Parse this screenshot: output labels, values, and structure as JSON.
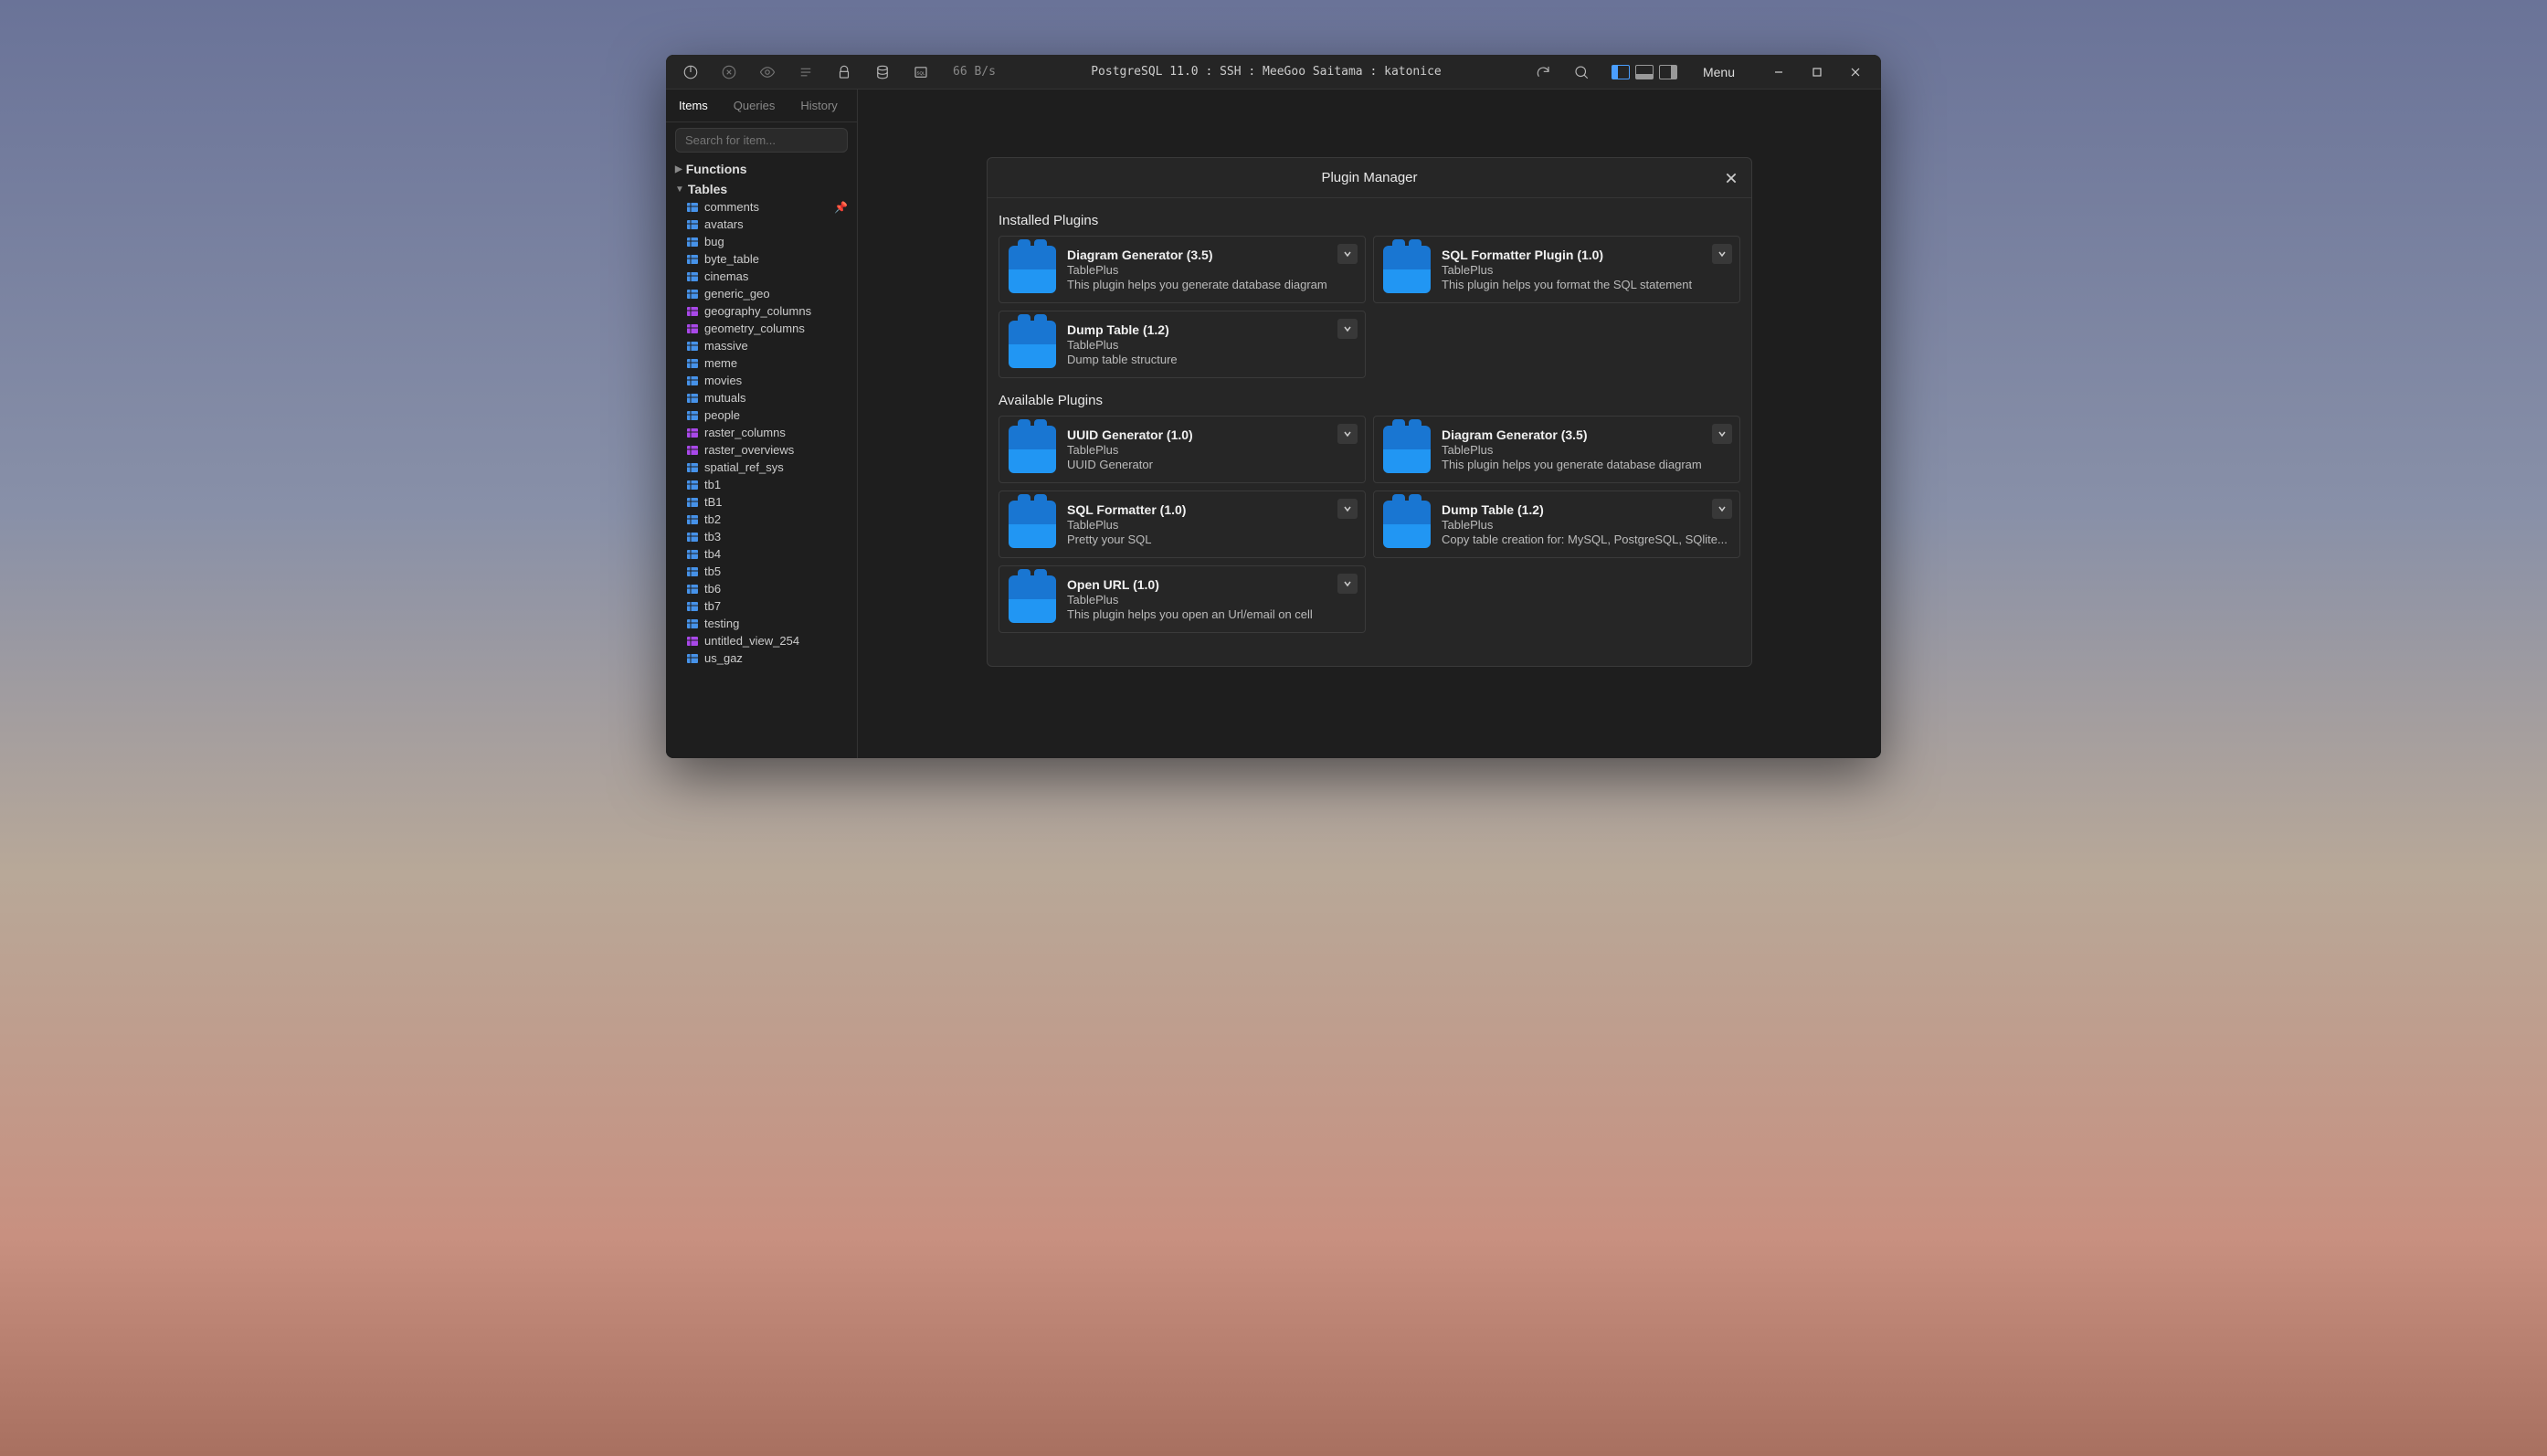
{
  "titlebar": {
    "status": "66 B/s",
    "connection": "PostgreSQL 11.0 : SSH : MeeGoo Saitama : katonice",
    "menu_label": "Menu"
  },
  "sidebar": {
    "tabs": [
      {
        "label": "Items",
        "active": true
      },
      {
        "label": "Queries",
        "active": false
      },
      {
        "label": "History",
        "active": false
      }
    ],
    "search_placeholder": "Search for item...",
    "sections": [
      {
        "label": "Functions",
        "expanded": false
      },
      {
        "label": "Tables",
        "expanded": true
      }
    ],
    "tables": [
      {
        "name": "comments",
        "kind": "table",
        "pinned": true
      },
      {
        "name": "avatars",
        "kind": "table"
      },
      {
        "name": "bug",
        "kind": "table"
      },
      {
        "name": "byte_table",
        "kind": "table"
      },
      {
        "name": "cinemas",
        "kind": "table"
      },
      {
        "name": "generic_geo",
        "kind": "table"
      },
      {
        "name": "geography_columns",
        "kind": "view"
      },
      {
        "name": "geometry_columns",
        "kind": "view"
      },
      {
        "name": "massive",
        "kind": "table"
      },
      {
        "name": "meme",
        "kind": "table"
      },
      {
        "name": "movies",
        "kind": "table"
      },
      {
        "name": "mutuals",
        "kind": "table"
      },
      {
        "name": "people",
        "kind": "table"
      },
      {
        "name": "raster_columns",
        "kind": "view"
      },
      {
        "name": "raster_overviews",
        "kind": "view"
      },
      {
        "name": "spatial_ref_sys",
        "kind": "table"
      },
      {
        "name": "tb1",
        "kind": "table"
      },
      {
        "name": "tB1",
        "kind": "table"
      },
      {
        "name": "tb2",
        "kind": "table"
      },
      {
        "name": "tb3",
        "kind": "table"
      },
      {
        "name": "tb4",
        "kind": "table"
      },
      {
        "name": "tb5",
        "kind": "table"
      },
      {
        "name": "tb6",
        "kind": "table"
      },
      {
        "name": "tb7",
        "kind": "table"
      },
      {
        "name": "testing",
        "kind": "table"
      },
      {
        "name": "untitled_view_254",
        "kind": "view"
      },
      {
        "name": "us_gaz",
        "kind": "table"
      }
    ]
  },
  "dialog": {
    "title": "Plugin Manager",
    "installed_label": "Installed Plugins",
    "available_label": "Available Plugins",
    "installed": [
      {
        "name": "Diagram Generator (3.5)",
        "author": "TablePlus",
        "desc": "This plugin helps you generate database diagram"
      },
      {
        "name": "SQL Formatter Plugin (1.0)",
        "author": "TablePlus",
        "desc": "This plugin helps you format the SQL statement"
      },
      {
        "name": "Dump Table (1.2)",
        "author": "TablePlus",
        "desc": "Dump table structure"
      }
    ],
    "available": [
      {
        "name": "UUID Generator (1.0)",
        "author": "TablePlus",
        "desc": "UUID Generator"
      },
      {
        "name": "Diagram Generator (3.5)",
        "author": "TablePlus",
        "desc": "This plugin helps you generate database diagram"
      },
      {
        "name": "SQL Formatter (1.0)",
        "author": "TablePlus",
        "desc": "Pretty your SQL"
      },
      {
        "name": "Dump Table (1.2)",
        "author": "TablePlus",
        "desc": "Copy table creation for: MySQL, PostgreSQL, SQlite..."
      },
      {
        "name": "Open URL (1.0)",
        "author": "TablePlus",
        "desc": "This plugin helps you open an Url/email on cell"
      }
    ]
  }
}
